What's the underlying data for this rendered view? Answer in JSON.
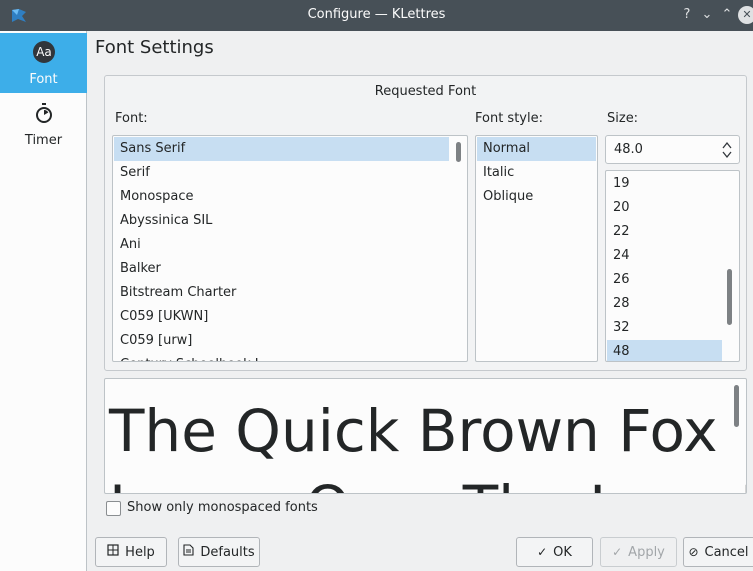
{
  "window": {
    "title": "Configure — KLettres",
    "help_glyph": "?",
    "minimize_glyph": "⌄",
    "maximize_glyph": "⌃",
    "close_glyph": "✕"
  },
  "sidebar": {
    "items": [
      {
        "label": "Font",
        "icon": "font-aa-icon",
        "icon_text": "Aa",
        "selected": true
      },
      {
        "label": "Timer",
        "icon": "stopwatch-icon",
        "selected": false
      }
    ]
  },
  "page": {
    "title": "Font Settings"
  },
  "requested_font": {
    "group_title": "Requested Font",
    "font_label": "Font:",
    "style_label": "Font style:",
    "size_label": "Size:",
    "fonts": [
      "Sans Serif",
      "Serif",
      "Monospace",
      "Abyssinica SIL",
      "Ani",
      "Balker",
      "Bitstream Charter",
      "C059 [UKWN]",
      "C059 [urw]",
      "Century Schoolbook L"
    ],
    "selected_font": "Sans Serif",
    "styles": [
      "Normal",
      "Italic",
      "Oblique"
    ],
    "selected_style": "Normal",
    "size_value": "48.0",
    "sizes": [
      "19",
      "20",
      "22",
      "24",
      "26",
      "28",
      "32",
      "48"
    ],
    "selected_size": "48"
  },
  "preview": {
    "line1": "The Quick Brown Fox",
    "line2": "Jumps Over The Lazy Dog"
  },
  "monospace_checkbox": {
    "label": "Show only monospaced fonts",
    "checked": false
  },
  "buttons": {
    "help": "Help",
    "defaults": "Defaults",
    "ok": "OK",
    "apply": "Apply",
    "cancel": "Cancel"
  },
  "colors": {
    "titlebar": "#475057",
    "selection": "#3daee9",
    "list_selection": "#c7def2"
  }
}
